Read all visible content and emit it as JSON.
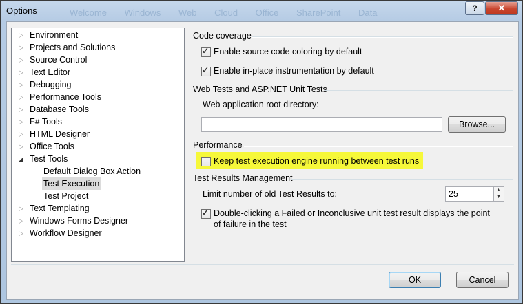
{
  "window": {
    "title": "Options",
    "background_tabs": [
      "Welcome",
      "Windows",
      "Web",
      "Cloud",
      "Office",
      "SharePoint",
      "Data"
    ],
    "help_label": "?",
    "close_label": "✕"
  },
  "tree": {
    "items": [
      {
        "label": "Environment",
        "expanded": false
      },
      {
        "label": "Projects and Solutions",
        "expanded": false
      },
      {
        "label": "Source Control",
        "expanded": false
      },
      {
        "label": "Text Editor",
        "expanded": false
      },
      {
        "label": "Debugging",
        "expanded": false
      },
      {
        "label": "Performance Tools",
        "expanded": false
      },
      {
        "label": "Database Tools",
        "expanded": false
      },
      {
        "label": "F# Tools",
        "expanded": false
      },
      {
        "label": "HTML Designer",
        "expanded": false
      },
      {
        "label": "Office Tools",
        "expanded": false
      },
      {
        "label": "Test Tools",
        "expanded": true
      },
      {
        "label": "Default Dialog Box Action",
        "child": true
      },
      {
        "label": "Test Execution",
        "child": true,
        "selected": true
      },
      {
        "label": "Test Project",
        "child": true
      },
      {
        "label": "Text Templating",
        "expanded": false
      },
      {
        "label": "Windows Forms Designer",
        "expanded": false
      },
      {
        "label": "Workflow Designer",
        "expanded": false
      }
    ]
  },
  "code_coverage": {
    "title": "Code coverage",
    "source_coloring_label": "Enable source code coloring by default",
    "source_coloring_checked": true,
    "inplace_label": "Enable in-place instrumentation by default",
    "inplace_checked": true
  },
  "web_tests": {
    "title": "Web Tests and ASP.NET Unit Tests",
    "root_dir_label": "Web application root directory:",
    "root_dir_value": "",
    "browse_label": "Browse..."
  },
  "performance": {
    "title": "Performance",
    "keep_engine_label": "Keep test execution engine running between test runs",
    "keep_engine_checked": false,
    "highlight_color": "#f6f83a"
  },
  "test_results": {
    "title": "Test Results Management",
    "limit_label": "Limit number of old Test Results to:",
    "limit_value": "25",
    "doubleclick_label_line1": "Double-clicking a Failed or Inconclusive unit test result displays the point",
    "doubleclick_label_line2": "of failure in the test",
    "doubleclick_checked": true
  },
  "footer": {
    "ok_label": "OK",
    "cancel_label": "Cancel"
  }
}
